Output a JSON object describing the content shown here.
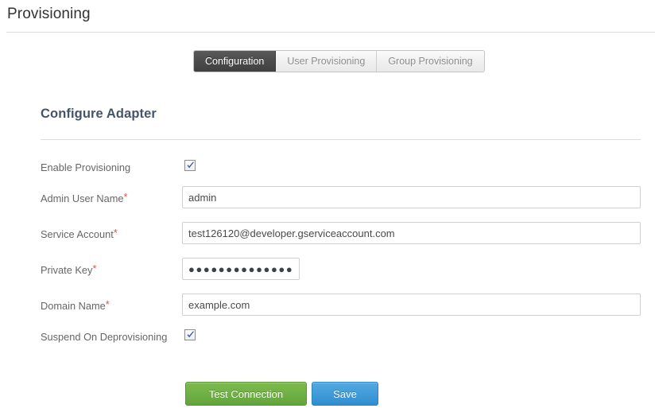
{
  "header": {
    "title": "Provisioning"
  },
  "tabs": [
    {
      "label": "Configuration",
      "active": true
    },
    {
      "label": "User Provisioning",
      "active": false
    },
    {
      "label": "Group Provisioning",
      "active": false
    }
  ],
  "form": {
    "section_title": "Configure Adapter",
    "required_marker": "*",
    "rows": [
      {
        "label": "Enable Provisioning",
        "type": "checkbox",
        "required": false,
        "checked": true
      },
      {
        "label": "Admin User Name",
        "type": "text",
        "required": true,
        "value": "admin",
        "placeholder": ""
      },
      {
        "label": "Service Account",
        "type": "text",
        "required": true,
        "value": "test126120@developer.gserviceaccount.com",
        "placeholder": ""
      },
      {
        "label": "Private Key",
        "type": "password",
        "required": true,
        "value": "●●●●●●●●●●●●●●●●●",
        "placeholder": ""
      },
      {
        "label": "Domain Name",
        "type": "text",
        "required": true,
        "value": "example.com",
        "placeholder": ""
      },
      {
        "label": "Suspend On Deprovisioning",
        "type": "checkbox",
        "required": false,
        "checked": true
      }
    ]
  },
  "buttons": {
    "test_connection": "Test Connection",
    "save": "Save"
  },
  "colors": {
    "accent_green": "#6fb045",
    "accent_blue": "#409ad8",
    "required_red": "#d9534f",
    "section_heading": "#44546a",
    "active_tab_bg": "#4c4c4c",
    "checkbox_check": "#3c5ca8"
  }
}
